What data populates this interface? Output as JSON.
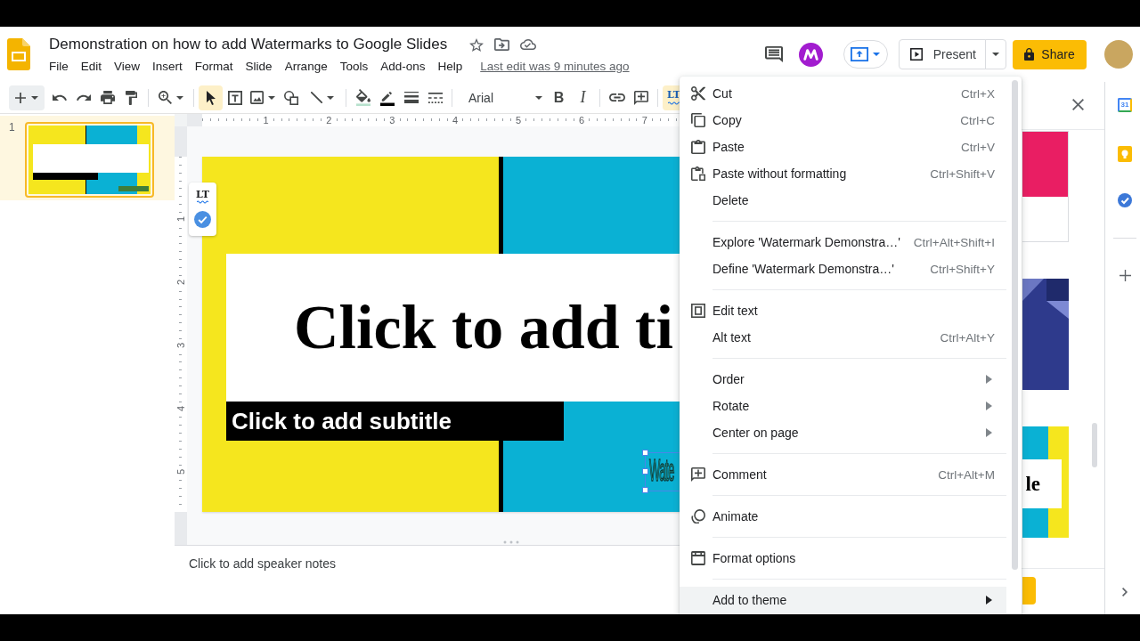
{
  "header": {
    "title": "Demonstration on how to add Watermarks to Google Slides",
    "menus": [
      {
        "label": "File"
      },
      {
        "label": "Edit"
      },
      {
        "label": "View"
      },
      {
        "label": "Insert"
      },
      {
        "label": "Format"
      },
      {
        "label": "Slide"
      },
      {
        "label": "Arrange"
      },
      {
        "label": "Tools"
      },
      {
        "label": "Add-ons"
      },
      {
        "label": "Help"
      }
    ],
    "last_edit": "Last edit was 9 minutes ago",
    "present_button": "Present",
    "share_button": "Share"
  },
  "toolbar": {
    "select_tool": {
      "selected": true
    },
    "font": "Arial",
    "bold_button": "B",
    "italic_button": "I",
    "language_tool": {
      "label": "LT",
      "selected": true
    }
  },
  "filmstrip": {
    "slides": [
      {
        "number": "1",
        "selected": true
      }
    ]
  },
  "editor": {
    "horizontal_ruler": [
      "1",
      "2",
      "3",
      "4",
      "5",
      "6",
      "7"
    ],
    "vertical_ruler": [
      "1",
      "2",
      "3",
      "4",
      "5"
    ],
    "grammar_badge": {
      "label": "LT"
    },
    "slide": {
      "title": "Click to add ti",
      "subtitle": "Click to add subtitle",
      "text_box": {
        "text": "Wate",
        "selected": true
      }
    },
    "speaker_notes": {
      "placeholder": "Click to add speaker notes"
    }
  },
  "themes_panel": {
    "themes": [
      {
        "kind": "split"
      },
      {
        "kind": "geometric"
      },
      {
        "kind": "striped",
        "text": "le"
      }
    ]
  },
  "side_panel": {
    "calendar_day": "31"
  },
  "context_menu": {
    "groups": [
      [
        {
          "label": "Cut",
          "shortcut": "Ctrl+X",
          "submenu": false,
          "selected": false
        },
        {
          "label": "Copy",
          "shortcut": "Ctrl+C",
          "submenu": false,
          "selected": false
        },
        {
          "label": "Paste",
          "shortcut": "Ctrl+V",
          "submenu": false,
          "selected": false
        },
        {
          "label": "Paste without formatting",
          "shortcut": "Ctrl+Shift+V",
          "submenu": false,
          "selected": false
        },
        {
          "label": "Delete",
          "submenu": false,
          "selected": false
        }
      ],
      [
        {
          "label": "Explore 'Watermark Demonstra…'",
          "shortcut": "Ctrl+Alt+Shift+I",
          "submenu": false,
          "selected": false
        },
        {
          "label": "Define 'Watermark Demonstra…'",
          "shortcut": "Ctrl+Shift+Y",
          "submenu": false,
          "selected": false
        }
      ],
      [
        {
          "label": "Edit text",
          "submenu": false,
          "selected": false
        },
        {
          "label": "Alt text",
          "shortcut": "Ctrl+Alt+Y",
          "submenu": false,
          "selected": false
        }
      ],
      [
        {
          "label": "Order",
          "submenu": true,
          "selected": false
        },
        {
          "label": "Rotate",
          "submenu": true,
          "selected": false
        },
        {
          "label": "Center on page",
          "submenu": true,
          "selected": false
        }
      ],
      [
        {
          "label": "Comment",
          "shortcut": "Ctrl+Alt+M",
          "submenu": false,
          "selected": false
        }
      ],
      [
        {
          "label": "Animate",
          "submenu": false,
          "selected": false
        }
      ],
      [
        {
          "label": "Format options",
          "submenu": false,
          "selected": false
        }
      ],
      [
        {
          "label": "Add to theme",
          "submenu": true,
          "selected": true
        }
      ]
    ]
  }
}
